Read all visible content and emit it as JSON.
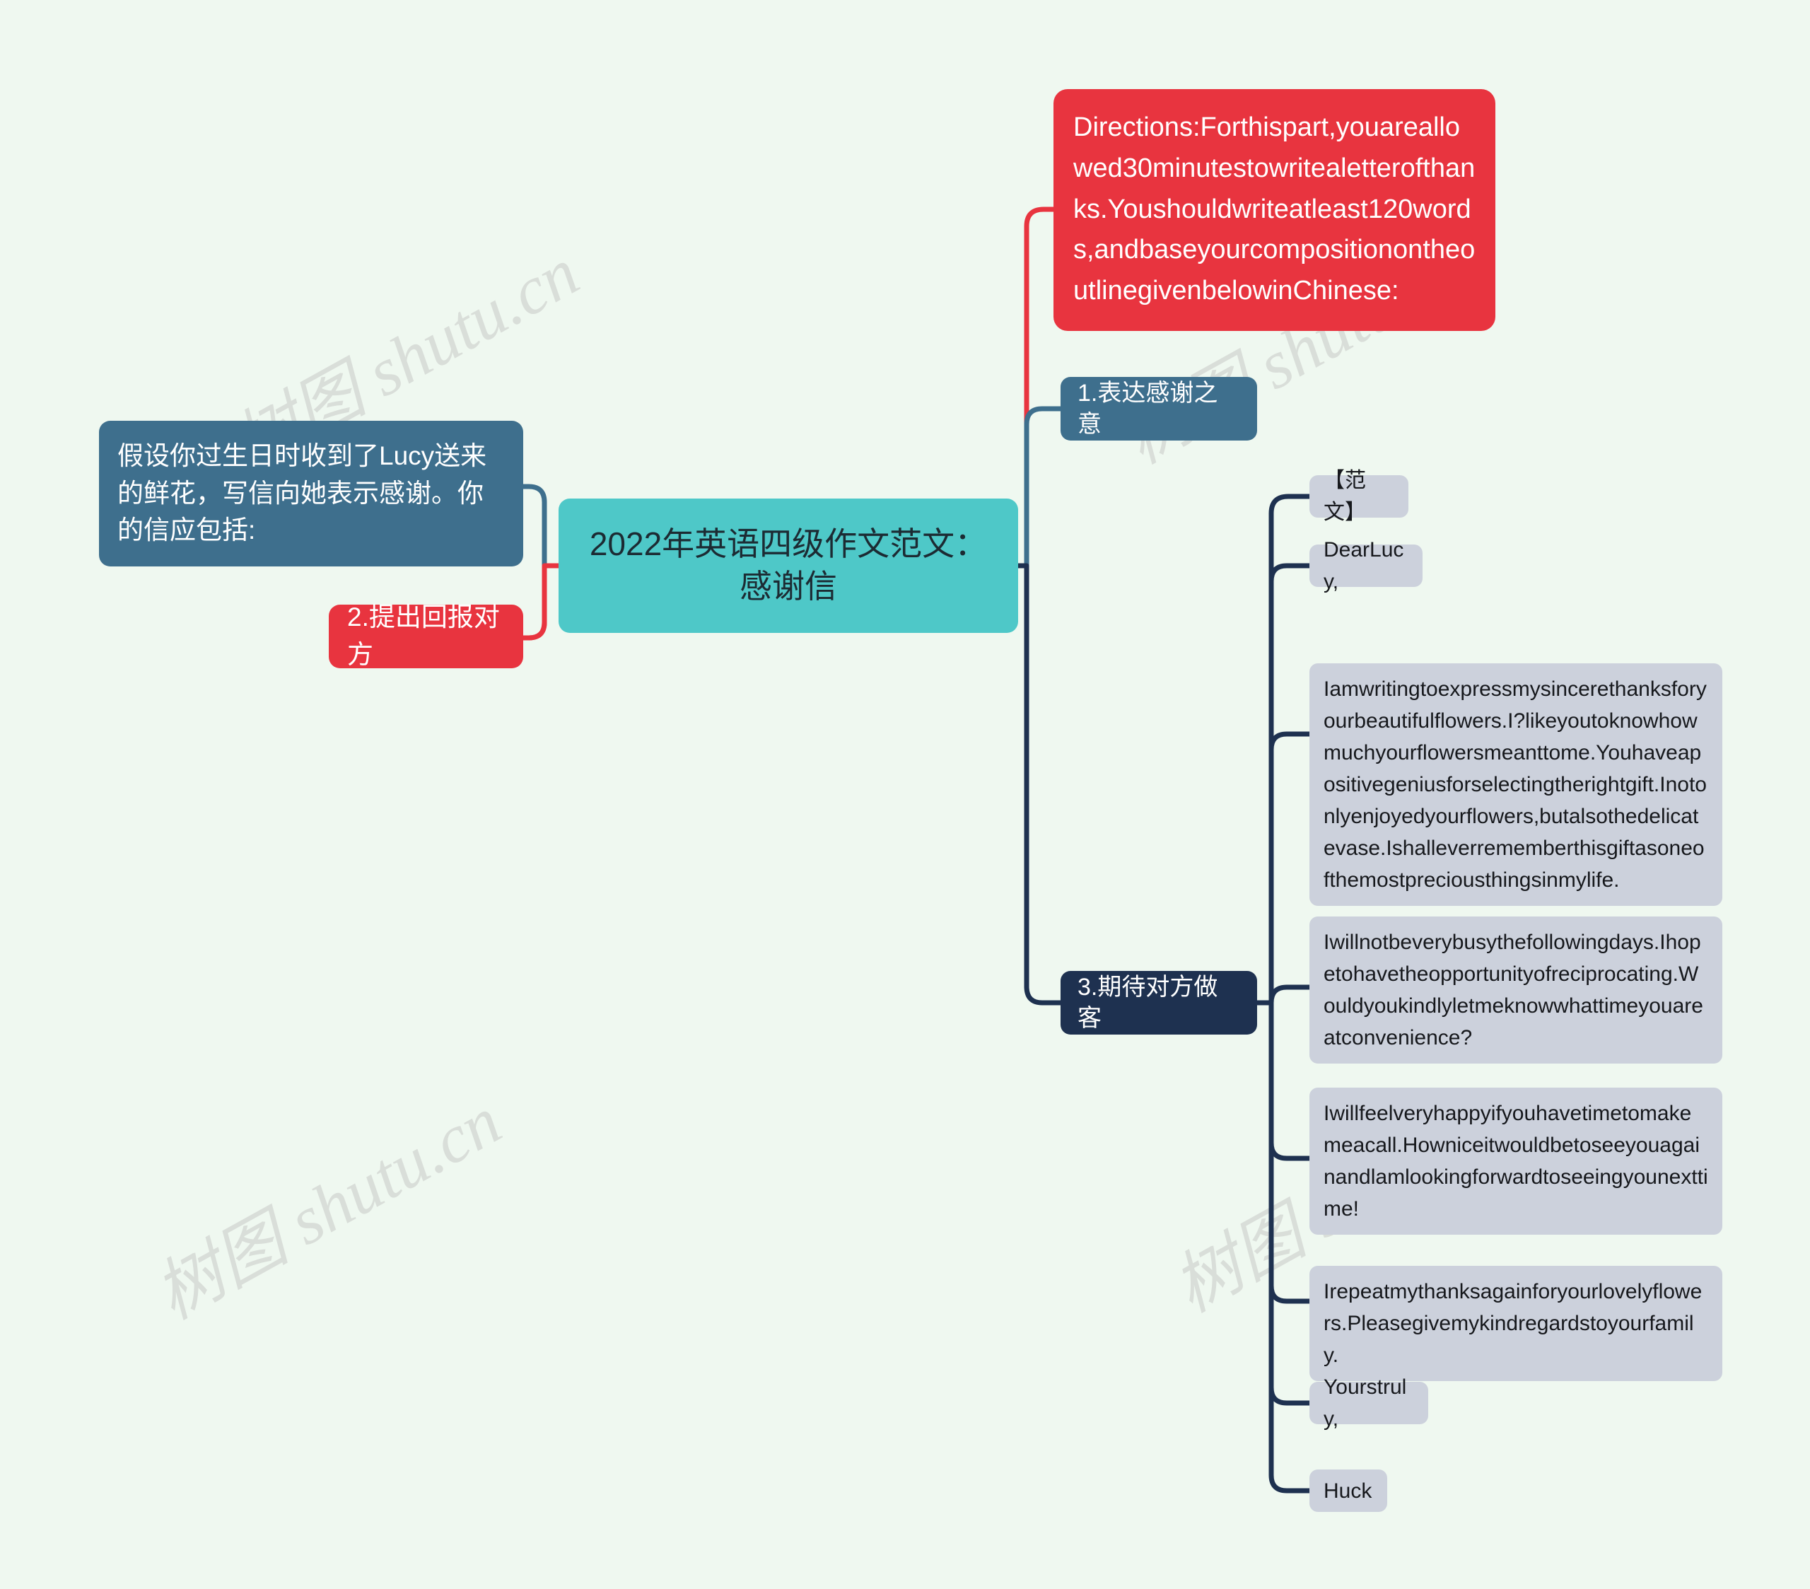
{
  "meta": {
    "background_color": "#eff8f0",
    "watermark_text": "树图 shutu.cn"
  },
  "colors": {
    "root": "#4ec8c8",
    "blue": "#3e6f8d",
    "red": "#e8343f",
    "navy": "#1e3150",
    "gray": "#ccd1dc",
    "root_text": "#1c2b33",
    "light_text": "#ffffff",
    "dark_text": "#16181c"
  },
  "root": {
    "label": "2022年英语四级作文范文：感谢信"
  },
  "left_branch": {
    "items": [
      {
        "id": "assumption",
        "label": "假设你过生日时收到了Lucy送来的鲜花，写信向她表示感谢。你的信应包括:",
        "style": "blue"
      },
      {
        "id": "point-2",
        "label": "2.提出回报对方",
        "style": "red"
      }
    ]
  },
  "right_branch": {
    "directions": {
      "label": "Directions:Forthispart,youareallowed30minutestowritealetterofthanks.Youshouldwriteatleast120words,andbaseyourcompositionontheoutlinegivenbelowinChinese:"
    },
    "point_1": {
      "label": "1.表达感谢之意"
    },
    "point_3": {
      "label": "3.期待对方做客",
      "children": [
        {
          "id": "sample-heading",
          "label": "【范文】",
          "kind": "short"
        },
        {
          "id": "salutation",
          "label": "DearLucy,",
          "kind": "short"
        },
        {
          "id": "para-1",
          "label": "Iamwritingtoexpressmysincerethanksforyourbeautifulflowers.I?likeyoutoknowhowmuchyourflowersmeanttome.Youhaveapositivegeniusforselectingtherightgift.Inotonlyenjoyedyourflowers,butalsothedelicatevase.Ishalleverrememberthisgiftasoneofthemostpreciousthingsinmylife.",
          "kind": "long"
        },
        {
          "id": "para-2",
          "label": "Iwillnotbeverybusythefollowingdays.Ihopetohavetheopportunityofreciprocating.Wouldyoukindlyletmeknowwhattimeyouareatconvenience?",
          "kind": "long"
        },
        {
          "id": "para-3",
          "label": "Iwillfeelveryhappyifyouhavetimetomakemeacall.Howniceitwouldbetoseeyouagainandlamlookingforwardtoseeingyounexttime!",
          "kind": "long"
        },
        {
          "id": "para-4",
          "label": "Irepeatmythanksagainforyourlovelyflowers.Pleasegivemykindregardstoyourfamily.",
          "kind": "long"
        },
        {
          "id": "closing",
          "label": "Yourstruly,",
          "kind": "short"
        },
        {
          "id": "signature",
          "label": "Huck",
          "kind": "short"
        }
      ]
    }
  }
}
